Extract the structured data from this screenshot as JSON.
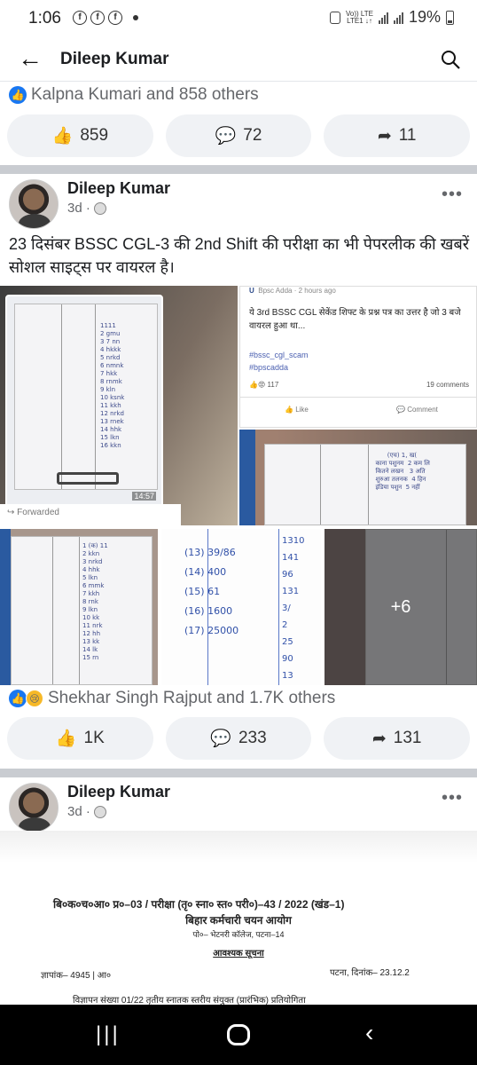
{
  "status": {
    "time": "1:06",
    "battery": "19%",
    "network": "Vo)) LTE\nLTE1 ↓↑"
  },
  "header": {
    "title": "Dileep Kumar"
  },
  "post0": {
    "reactions": "Kalpna Kumari and 858 others",
    "likes": "859",
    "comments": "72",
    "shares": "11"
  },
  "post1": {
    "author": "Dileep Kumar",
    "time": "3d ·",
    "text": "23 दिसंबर BSSC CGL-3 की 2nd Shift की परीक्षा का भी पेपरलीक की खबरें सोशल साइट्स पर वायरल है।",
    "image1": {
      "timestamp": "14:57",
      "forwarded": "Forwarded"
    },
    "image2": {
      "page": "Bpsc Adda",
      "time": "2 hours ago",
      "text": "ये 3rd BSSC CGL सेकेंड शिफ्ट के प्रश्न पत्र का उत्तर है जो 3 बजे वायरल हुआ था...",
      "tags": [
        "#bssc_cgl_scam",
        "#bpscadda"
      ],
      "reacts": "117",
      "comments": "19 comments",
      "like": "Like",
      "comment": "Comment"
    },
    "image4": {
      "values": [
        "39/86",
        "400",
        "61",
        "1600",
        "25000"
      ],
      "right": [
        "1310",
        "141",
        "96",
        "131",
        "3/",
        "2",
        "25",
        "90",
        "13"
      ]
    },
    "more": "+6",
    "reactions": "Shekhar Singh Rajput and 1.7K others",
    "likes": "1K",
    "comments": "233",
    "shares": "131"
  },
  "post2": {
    "author": "Dileep Kumar",
    "time": "3d ·",
    "notice": {
      "line1": "बि०क०च०आ० प्र०–03 / परीक्षा (तृ० स्ना० स्त० परी०)–43 / 2022 (खंड–1)",
      "line2": "बिहार कर्मचारी चयन आयोग",
      "line3": "पो०– भेटनरी कॉलेज, पटना–14",
      "line4": "आवश्यक सूचना",
      "ref": "ज्ञापांक– 4945 | आ०",
      "date": "पटना, दिनांक– 23.12.2",
      "last": "विज्ञापन संख्या 01/22 तृतीय स्नातक स्तरीय संयुक्त (प्रारंभिक) प्रतियोगिता"
    }
  },
  "colors": {
    "accent": "#1877f2",
    "separator": "#c9ccd1",
    "button_bg": "#f0f2f5"
  }
}
